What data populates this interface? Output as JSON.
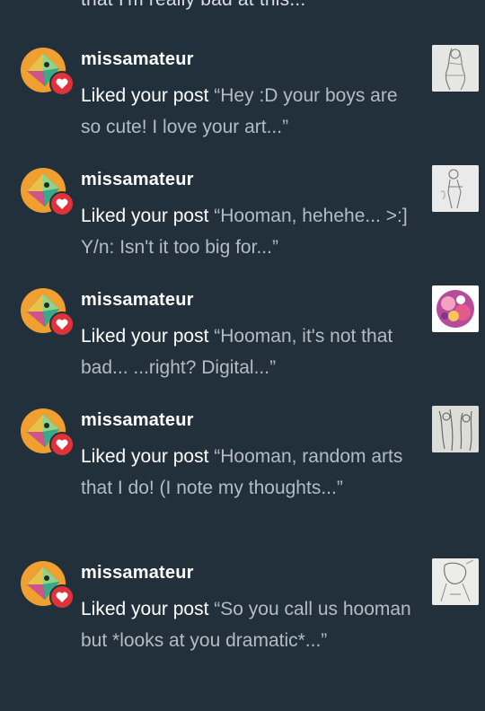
{
  "top_fragment": "that I'm really bad at this...",
  "activity": [
    {
      "username": "missamateur",
      "action": "Liked your post",
      "snippet": "“Hey :D your boys are so cute! I love your art...”",
      "thumbnail_icon": "sketch-thumbnail"
    },
    {
      "username": "missamateur",
      "action": "Liked your post",
      "snippet": "“Hooman, hehehe... >:]  Y/n: Isn't it too big for...”",
      "thumbnail_icon": "sketch-thumbnail"
    },
    {
      "username": "missamateur",
      "action": "Liked your post",
      "snippet": "“Hooman, it's not that bad... ...right? Digital...”",
      "thumbnail_icon": "digital-art-thumbnail"
    },
    {
      "username": "missamateur",
      "action": "Liked your post",
      "snippet": "“Hooman, random arts that I do! (I note my thoughts...”",
      "thumbnail_icon": "sketch-thumbnail"
    },
    {
      "username": "missamateur",
      "action": "Liked your post",
      "snippet": "“So you call us hooman but *looks at you dramatic*...”",
      "thumbnail_icon": "sketch-thumbnail"
    }
  ],
  "colors": {
    "background": "#22303b",
    "heart_badge": "#e0323b",
    "avatar_orange": "#f0a030"
  }
}
